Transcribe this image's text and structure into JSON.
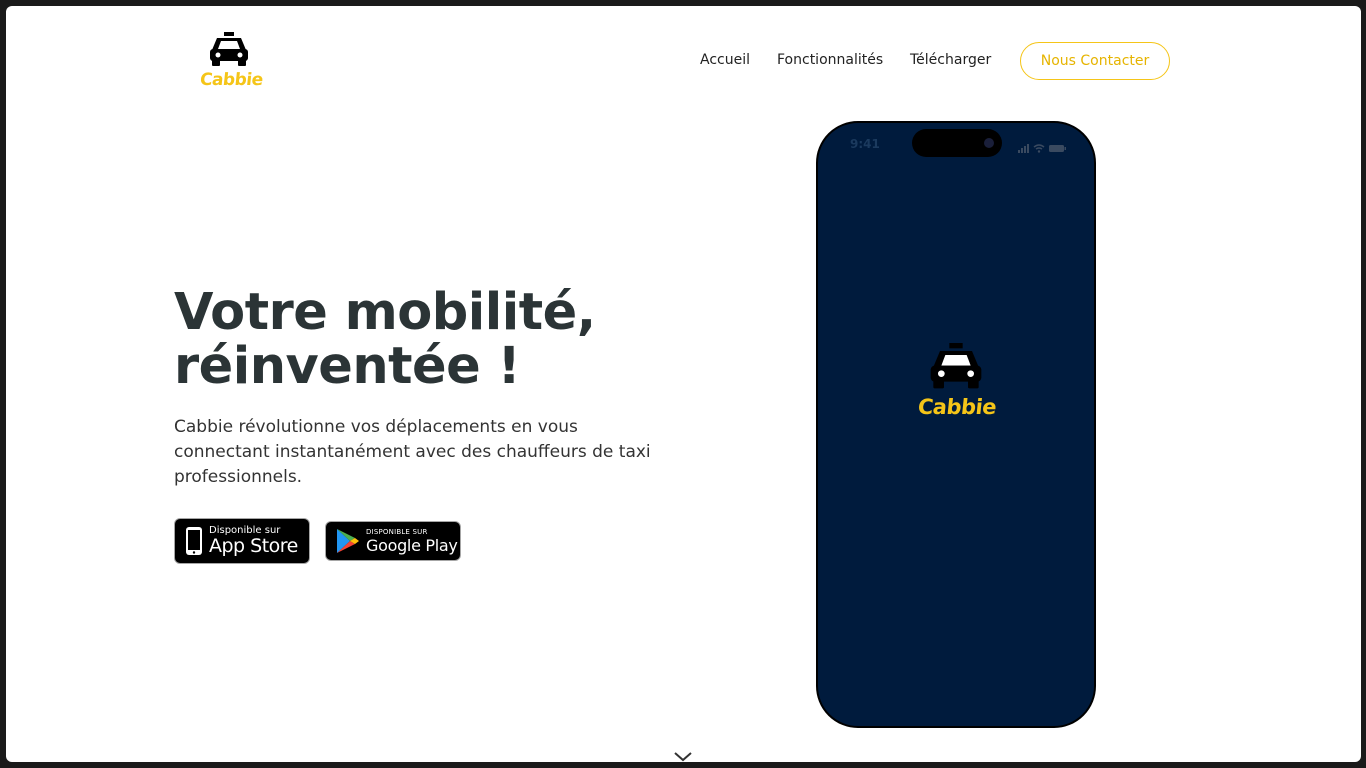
{
  "brand": {
    "name": "Cabbie",
    "accent_color": "#f5c518",
    "dark_color": "#001b3d"
  },
  "nav": {
    "links": [
      "Accueil",
      "Fonctionnalités",
      "Télécharger"
    ],
    "contact_label": "Nous Contacter"
  },
  "hero": {
    "title": "Votre mobilité, réinventée !",
    "description": "Cabbie révolutionne vos déplacements en vous connectant instantanément avec des chauffeurs de taxi professionnels."
  },
  "stores": {
    "appstore": {
      "small": "Disponible sur",
      "big": "App Store"
    },
    "googleplay": {
      "small": "DISPONIBLE SUR",
      "big": "Google Play"
    }
  },
  "phone": {
    "time": "9:41",
    "app_name": "Cabbie"
  },
  "icons": [
    "taxi-icon",
    "apple-icon",
    "google-play-icon",
    "signal-icon",
    "wifi-icon",
    "battery-icon",
    "chevron-down-icon"
  ]
}
